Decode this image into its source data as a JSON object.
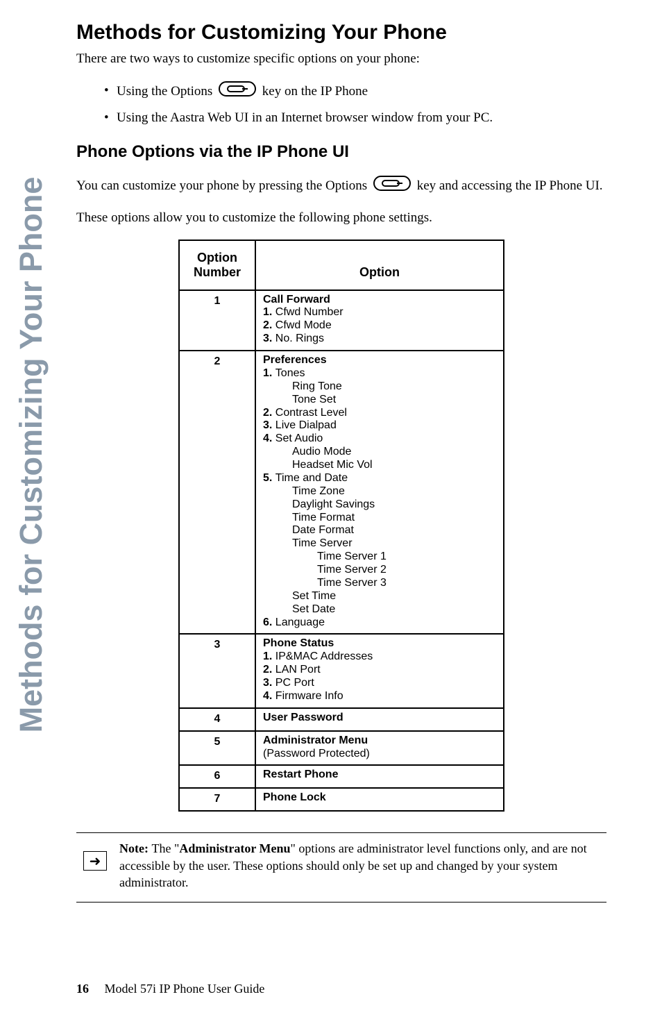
{
  "side_tab": "Methods for Customizing Your Phone",
  "title": "Methods for Customizing Your Phone",
  "intro": "There are two ways to customize specific options on your phone:",
  "bullets": [
    {
      "pre": "Using the Options ",
      "post": " key on the IP Phone"
    },
    {
      "pre": "Using the Aastra Web UI in an Internet browser window from your PC.",
      "post": ""
    }
  ],
  "subsection": "Phone Options via the IP Phone UI",
  "body1_pre": "You can customize your phone by pressing the Options ",
  "body1_post": " key and accessing the IP Phone UI.",
  "body2": "These options allow you to customize the following phone settings.",
  "table": {
    "headers": [
      "Option Number",
      "Option"
    ],
    "rows": [
      {
        "num": "1",
        "title": "Call Forward",
        "lines": [
          {
            "n": "1.",
            "t": "Cfwd Number"
          },
          {
            "n": "2.",
            "t": "Cfwd Mode"
          },
          {
            "n": "3.",
            "t": "No. Rings"
          }
        ]
      },
      {
        "num": "2",
        "title": "Preferences",
        "lines": [
          {
            "n": "1.",
            "t": "Tones"
          },
          {
            "sub1": "Ring Tone"
          },
          {
            "sub1": "Tone Set"
          },
          {
            "n": "2.",
            "t": "Contrast Level"
          },
          {
            "n": "3.",
            "t": "Live Dialpad"
          },
          {
            "n": "4.",
            "t": "Set Audio"
          },
          {
            "sub1": "Audio Mode"
          },
          {
            "sub1": "Headset Mic Vol"
          },
          {
            "n": "5.",
            "t": "Time and Date"
          },
          {
            "sub1": "Time Zone"
          },
          {
            "sub1": "Daylight Savings"
          },
          {
            "sub1": "Time Format"
          },
          {
            "sub1": "Date Format"
          },
          {
            "sub1": "Time Server"
          },
          {
            "sub2": "Time Server 1"
          },
          {
            "sub2": "Time Server 2"
          },
          {
            "sub2": "Time Server 3"
          },
          {
            "sub1": "Set Time"
          },
          {
            "sub1": "Set Date"
          },
          {
            "n": "6.",
            "t": "Language"
          }
        ]
      },
      {
        "num": "3",
        "title": "Phone Status",
        "lines": [
          {
            "n": "1.",
            "t": "IP&MAC Addresses"
          },
          {
            "n": "2.",
            "t": "LAN Port"
          },
          {
            "n": "3.",
            "t": "PC Port"
          },
          {
            "n": "4.",
            "t": "Firmware Info"
          }
        ]
      },
      {
        "num": "4",
        "title": "User Password",
        "lines": []
      },
      {
        "num": "5",
        "title": "Administrator Menu",
        "lines": [
          {
            "plain": "(Password Protected)"
          }
        ]
      },
      {
        "num": "6",
        "title": "Restart Phone",
        "lines": []
      },
      {
        "num": "7",
        "title": "Phone Lock",
        "lines": []
      }
    ]
  },
  "note": {
    "label": "Note: ",
    "pre": "The \"",
    "bold": "Administrator Menu",
    "post": "\" options are administrator level functions only, and are not accessible by the user. These options should only be set up and changed by your system administrator."
  },
  "footer": {
    "page": "16",
    "text": "Model 57i IP Phone User Guide"
  },
  "icons": {
    "options_key": "options-key-icon",
    "note_arrow": "➜"
  }
}
